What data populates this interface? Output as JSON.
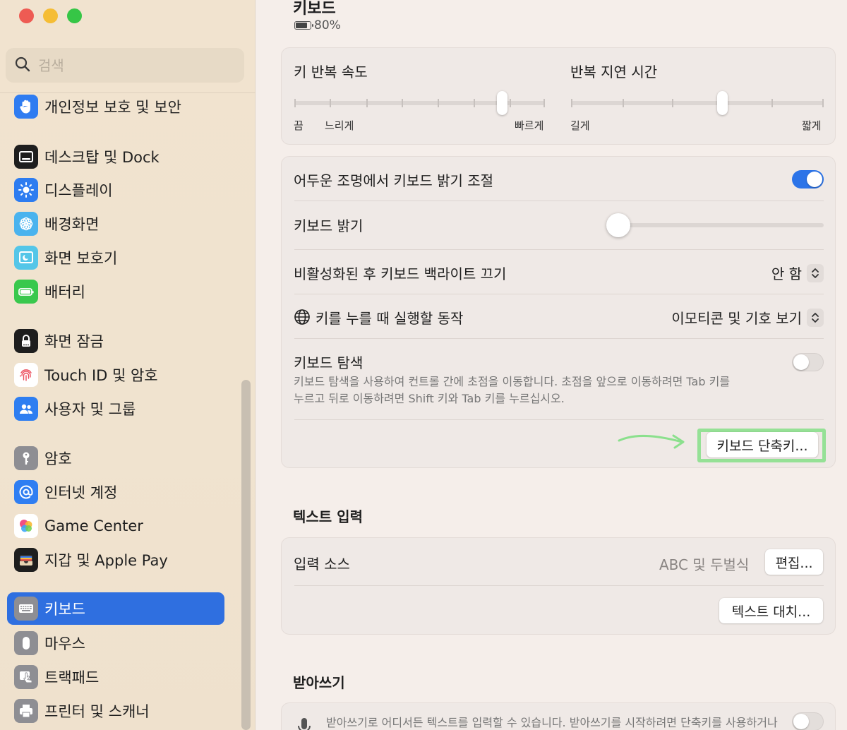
{
  "sidebar": {
    "search_placeholder": "검색",
    "partial_item": {
      "label": "개인정보 보호 및 보안",
      "icon": "hand-icon"
    },
    "groups": [
      [
        {
          "label": "데스크탑 및 Dock",
          "icon": "dock-icon"
        },
        {
          "label": "디스플레이",
          "icon": "sun-icon"
        },
        {
          "label": "배경화면",
          "icon": "flower-icon"
        },
        {
          "label": "화면 보호기",
          "icon": "screensaver-icon"
        },
        {
          "label": "배터리",
          "icon": "battery-icon"
        }
      ],
      [
        {
          "label": "화면 잠금",
          "icon": "lock-icon"
        },
        {
          "label": "Touch ID 및 암호",
          "icon": "fingerprint-icon"
        },
        {
          "label": "사용자 및 그룹",
          "icon": "users-icon"
        }
      ],
      [
        {
          "label": "암호",
          "icon": "key-icon"
        },
        {
          "label": "인터넷 계정",
          "icon": "at-icon"
        },
        {
          "label": "Game Center",
          "icon": "game-center-icon"
        },
        {
          "label": "지갑 및 Apple Pay",
          "icon": "wallet-icon"
        }
      ],
      [
        {
          "label": "키보드",
          "icon": "keyboard-icon",
          "selected": true
        },
        {
          "label": "마우스",
          "icon": "mouse-icon"
        },
        {
          "label": "트랙패드",
          "icon": "trackpad-icon"
        },
        {
          "label": "프린터 및 스캐너",
          "icon": "printer-icon"
        }
      ]
    ]
  },
  "header": {
    "title": "키보드",
    "battery_level": "80%"
  },
  "repeat": {
    "key_repeat_label": "키 반복 속도",
    "key_repeat_min": "끔",
    "key_repeat_slow": "느리게",
    "key_repeat_fast": "빠르게",
    "key_repeat_value": 0.83,
    "delay_label": "반복 지연 시간",
    "delay_long": "길게",
    "delay_short": "짧게",
    "delay_value": 0.6
  },
  "backlight": {
    "auto_adjust_label": "어두운 조명에서 키보드 밝기 조절",
    "auto_adjust_on": true,
    "brightness_label": "키보드 밝기",
    "brightness_value": 0.05,
    "turn_off_label": "비활성화된 후 키보드 백라이트 끄기",
    "turn_off_value": "안 함",
    "globe_label": "키를 누를 때 실행할 동작",
    "globe_value": "이모티콘 및 기호 보기",
    "nav_label": "키보드 탐색",
    "nav_on": false,
    "nav_desc_line1": "키보드 탐색을 사용하여 컨트롤 간에 초점을 이동합니다. 초점을 앞으로 이동하려면 Tab 키를",
    "nav_desc_line2": "누르고 뒤로 이동하려면 Shift 키와 Tab 키를 누르십시오.",
    "shortcuts_button": "키보드 단축키..."
  },
  "text_input": {
    "section_title": "텍스트 입력",
    "input_sources_label": "입력 소스",
    "input_sources_value": "ABC 및 두벌식",
    "edit_button": "편집...",
    "text_replacements_button": "텍스트 대치..."
  },
  "dictation": {
    "section_title": "받아쓰기",
    "desc": "받아쓰기로 어디서든 텍스트를 입력할 수 있습니다. 받아쓰기를 시작하려면 단축키를 사용하거나",
    "on": false
  },
  "colors": {
    "accent": "#2c74e8",
    "highlight": "#8be08d"
  }
}
